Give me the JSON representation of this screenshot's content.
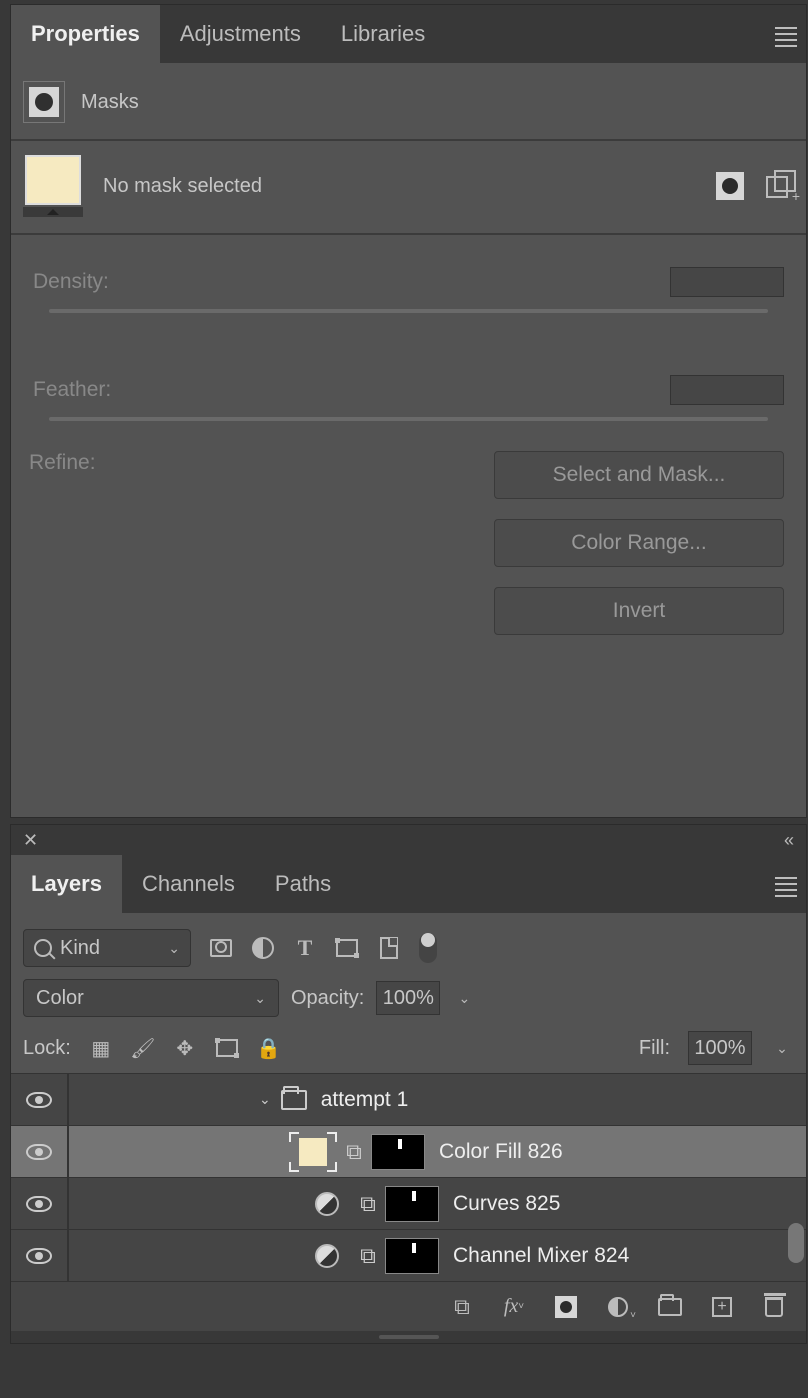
{
  "propertiesPanel": {
    "tabs": [
      "Properties",
      "Adjustments",
      "Libraries"
    ],
    "activeTab": "Properties",
    "section": "Masks",
    "statusText": "No mask selected",
    "density": {
      "label": "Density:"
    },
    "feather": {
      "label": "Feather:"
    },
    "refine": {
      "label": "Refine:",
      "buttons": [
        "Select and Mask...",
        "Color Range...",
        "Invert"
      ]
    }
  },
  "layersPanel": {
    "tabs": [
      "Layers",
      "Channels",
      "Paths"
    ],
    "activeTab": "Layers",
    "filter": {
      "kindLabel": "Kind"
    },
    "blend": {
      "mode": "Color",
      "opacityLabel": "Opacity:",
      "opacityValue": "100%"
    },
    "lock": {
      "label": "Lock:",
      "fillLabel": "Fill:",
      "fillValue": "100%"
    },
    "layers": [
      {
        "name": "attempt 1",
        "type": "group"
      },
      {
        "name": "Color Fill 826",
        "type": "fill",
        "selected": true
      },
      {
        "name": "Curves 825",
        "type": "adjustment"
      },
      {
        "name": "Channel Mixer 824",
        "type": "adjustment"
      }
    ]
  }
}
